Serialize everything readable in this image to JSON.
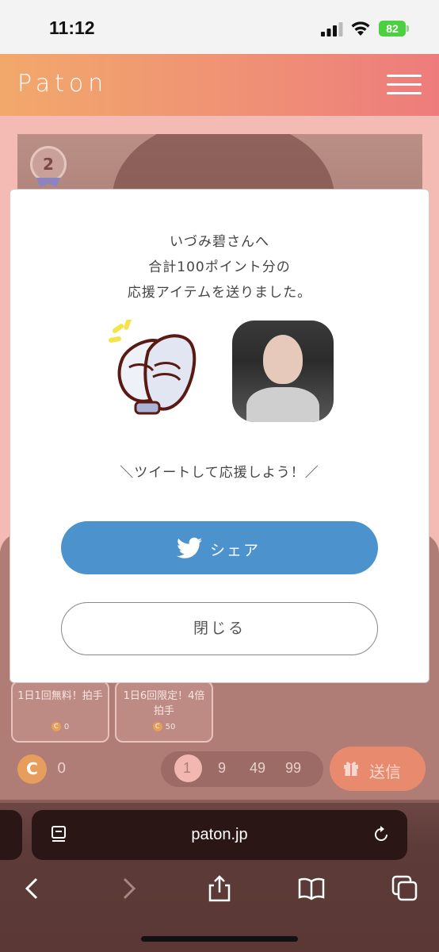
{
  "status": {
    "time": "11:12",
    "battery": "82"
  },
  "app": {
    "logo": "Paton"
  },
  "rank": {
    "number": "2"
  },
  "items": [
    {
      "label": "1日1回無料！拍手",
      "price": "0"
    },
    {
      "label": "1日6回限定！4倍拍手",
      "price": "50"
    }
  ],
  "coins": {
    "symbol": "C",
    "balance": "0"
  },
  "quantities": [
    "1",
    "9",
    "49",
    "99"
  ],
  "send": {
    "label": "送信"
  },
  "modal": {
    "line1": "いづみ碧さんへ",
    "line2": "合計100ポイント分の",
    "line3": "応援アイテムを送りました。",
    "cta": "＼ツイートして応援しよう！／",
    "share_label": "シェア",
    "close_label": "閉じる"
  },
  "browser": {
    "url": "paton.jp"
  },
  "colors": {
    "accent": "#4c93cd",
    "header_start": "#f2a86b",
    "header_end": "#ee7c7c"
  }
}
